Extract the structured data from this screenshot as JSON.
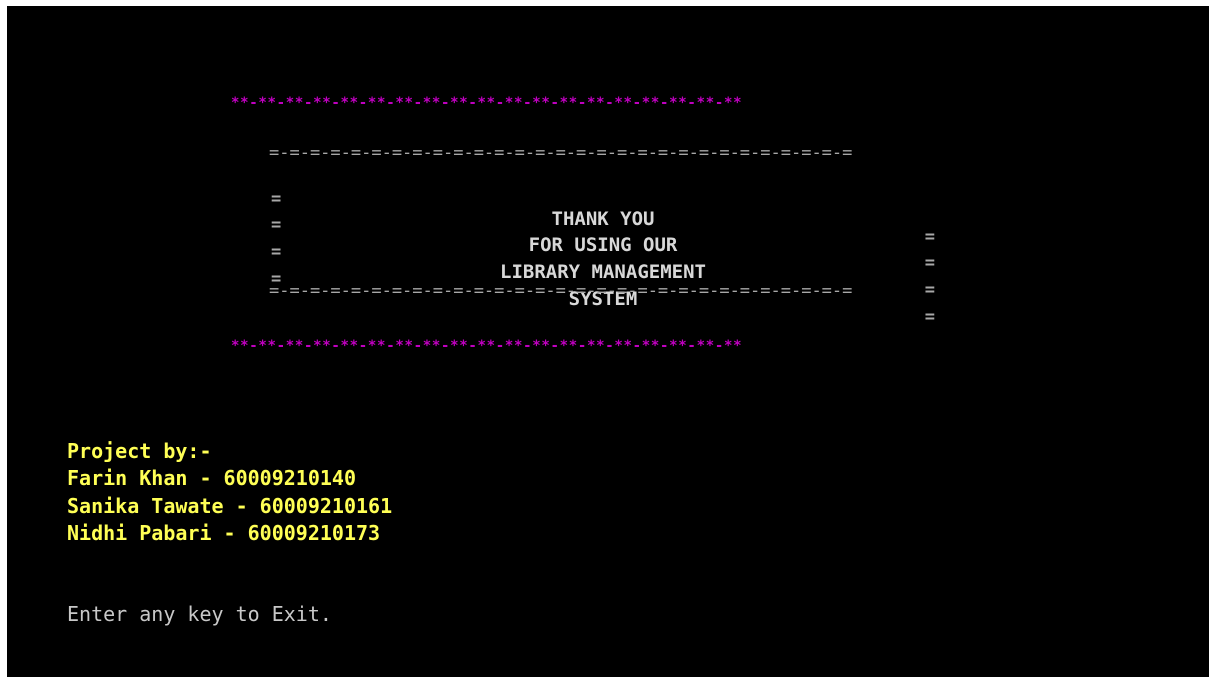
{
  "colors": {
    "background": "#000000",
    "border_magenta": "#c000c0",
    "border_gray": "#a8a8a8",
    "message_text": "#d8d8d8",
    "credits_yellow": "#ffff55",
    "prompt_text": "#c8c8c8"
  },
  "border": {
    "star_pattern": "**-**-**-**-**-**-**-**-**-**-**-**-**-**-**-**-**-**-**",
    "equals_pattern": "=-=-=-=-=-=-=-=-=-=-=-=-=-=-=-=-=-=-=-=-=-=-=-=-=-=-=-=-=",
    "side_char": "="
  },
  "message": {
    "line1": "THANK YOU",
    "line2": "FOR USING OUR",
    "line3": "LIBRARY MANAGEMENT",
    "line4": "SYSTEM"
  },
  "credits": {
    "heading": "Project by:-",
    "members": [
      "Farin Khan - 60009210140",
      "Sanika Tawate - 60009210161",
      "Nidhi Pabari - 60009210173"
    ]
  },
  "prompt": "Enter any key to Exit."
}
